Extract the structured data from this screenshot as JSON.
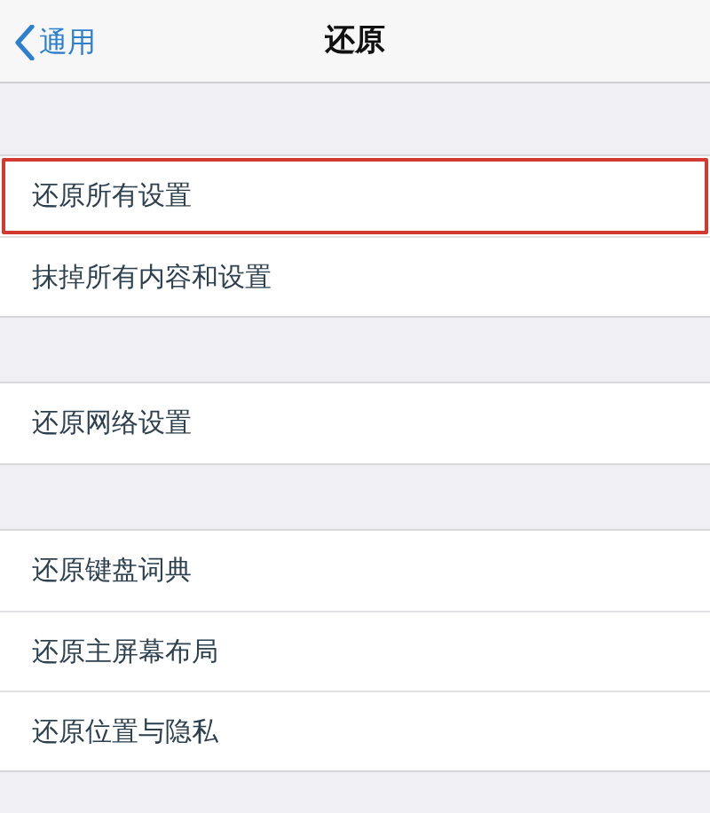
{
  "nav_bar": {
    "back_label": "通用",
    "title": "还原"
  },
  "groups": [
    {
      "items": [
        {
          "label": "还原所有设置",
          "highlighted": true
        },
        {
          "label": "抹掉所有内容和设置",
          "highlighted": false
        }
      ]
    },
    {
      "items": [
        {
          "label": "还原网络设置",
          "highlighted": false
        }
      ]
    },
    {
      "items": [
        {
          "label": "还原键盘词典",
          "highlighted": false
        },
        {
          "label": "还原主屏幕布局",
          "highlighted": false
        },
        {
          "label": "还原位置与隐私",
          "highlighted": false
        }
      ]
    }
  ]
}
